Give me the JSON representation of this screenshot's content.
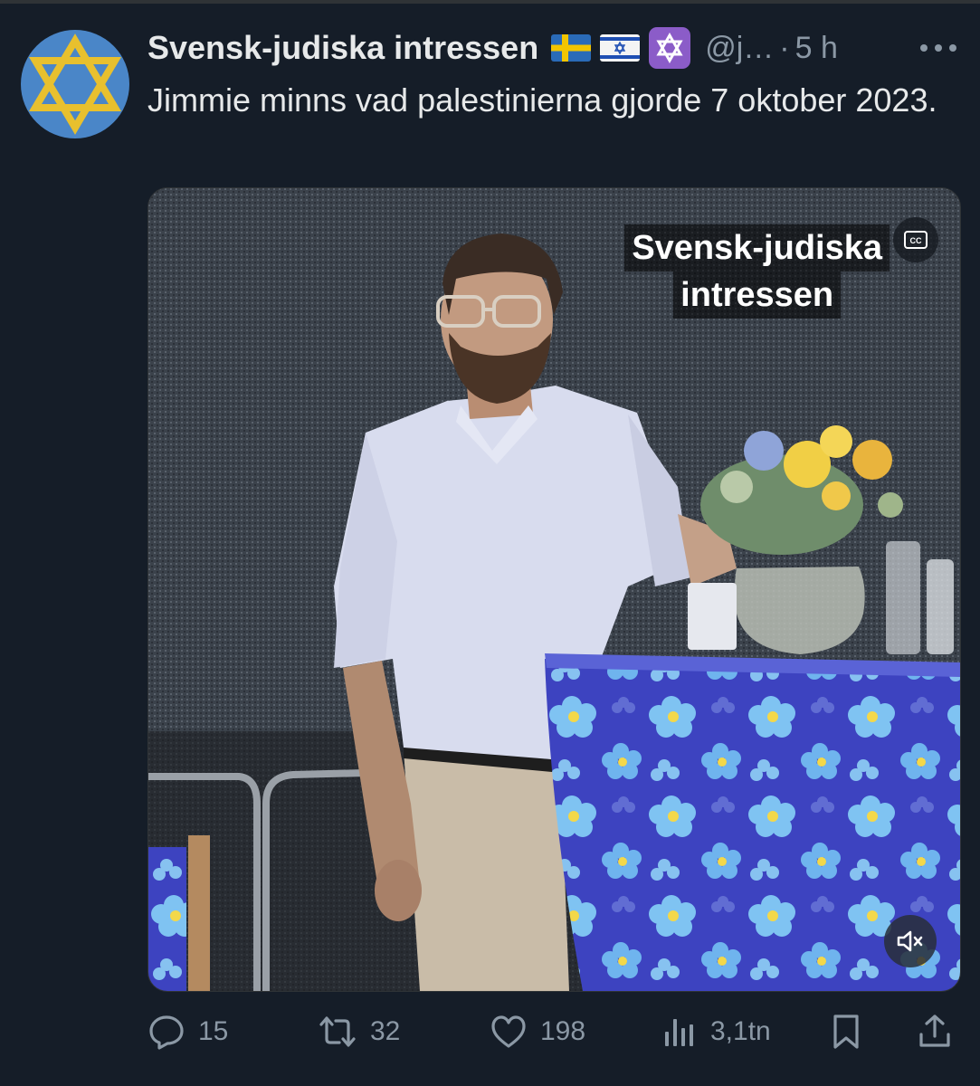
{
  "tweet": {
    "author_name": "Svensk-judiska intressen",
    "handle": "@j…",
    "separator": "·",
    "time": "5 h",
    "text": "Jimmie minns vad palestinierna gjorde 7 oktober 2023."
  },
  "media": {
    "watermark_line1": "Svensk-judiska",
    "watermark_line2": "intressen",
    "cc_label": "CC"
  },
  "actions": {
    "replies": "15",
    "reposts": "32",
    "likes": "198",
    "views": "3,1tn"
  },
  "colors": {
    "background": "#151d28",
    "text": "#e7e9ea",
    "muted": "#8b98a5",
    "avatar_blue": "#4a86c8",
    "star_gold": "#e8c02e"
  },
  "icons": [
    "star-of-david-icon",
    "sweden-flag-icon",
    "israel-flag-icon",
    "more-icon",
    "cc-icon",
    "mute-icon",
    "reply-icon",
    "repost-icon",
    "like-icon",
    "views-icon",
    "bookmark-icon",
    "share-icon"
  ]
}
